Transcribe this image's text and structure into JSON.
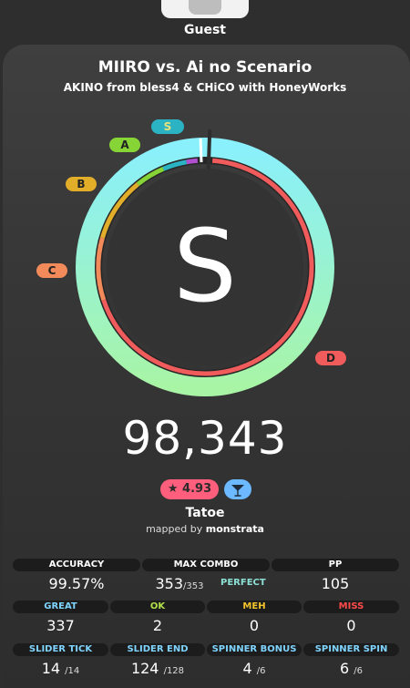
{
  "user": {
    "name": "Guest"
  },
  "beatmap": {
    "title": "MIIRO vs. Ai no Scenario",
    "artist": "AKINO from bless4 & CHiCO with HoneyWorks",
    "difficulty_name": "Tatoe",
    "mapped_by_label": "mapped by",
    "mapper": "monstrata",
    "star_rating": "4.93",
    "mode_icon": "cocktail-glass-icon"
  },
  "result": {
    "rank": "S",
    "score": "98,343",
    "accuracy_fraction": 0.9957
  },
  "rank_markers": [
    {
      "label": "S",
      "color": "#2bb3c4",
      "text_color": "#e9e27a"
    },
    {
      "label": "A",
      "color": "#87d436"
    },
    {
      "label": "B",
      "color": "#e2ad28"
    },
    {
      "label": "C",
      "color": "#f28a5a"
    },
    {
      "label": "D",
      "color": "#f05b5b"
    }
  ],
  "stats": {
    "accuracy": {
      "label": "ACCURACY",
      "value": "99.57%"
    },
    "max_combo": {
      "label": "MAX COMBO",
      "value": "353",
      "max": "/353",
      "badge": "PERFECT"
    },
    "pp": {
      "label": "PP",
      "value": "105"
    },
    "great": {
      "label": "GREAT",
      "value": "337",
      "color": "#7fd4ff"
    },
    "ok": {
      "label": "OK",
      "value": "2",
      "color": "#b3e04a"
    },
    "meh": {
      "label": "MEH",
      "value": "0",
      "color": "#f2c52b"
    },
    "miss": {
      "label": "MISS",
      "value": "0",
      "color": "#ff4a4a"
    },
    "slider_tick": {
      "label": "SLIDER TICK",
      "value": "14",
      "max": "/14",
      "color": "#7fd4ff"
    },
    "slider_end": {
      "label": "SLIDER END",
      "value": "124",
      "max": "/128",
      "color": "#7fd4ff"
    },
    "spinner_bonus": {
      "label": "SPINNER BONUS",
      "value": "4",
      "max": "/6",
      "color": "#7fd4ff"
    },
    "spinner_spin": {
      "label": "SPINNER SPIN",
      "value": "6",
      "max": "/6",
      "color": "#7fd4ff"
    }
  },
  "colors": {
    "ring_gradient_top": "#8af0fb",
    "ring_gradient_bottom": "#a8f5a6",
    "progress_ring": "#f05b5b",
    "star_badge": "#ff5f7c",
    "mode_badge": "#6cb9ff"
  }
}
